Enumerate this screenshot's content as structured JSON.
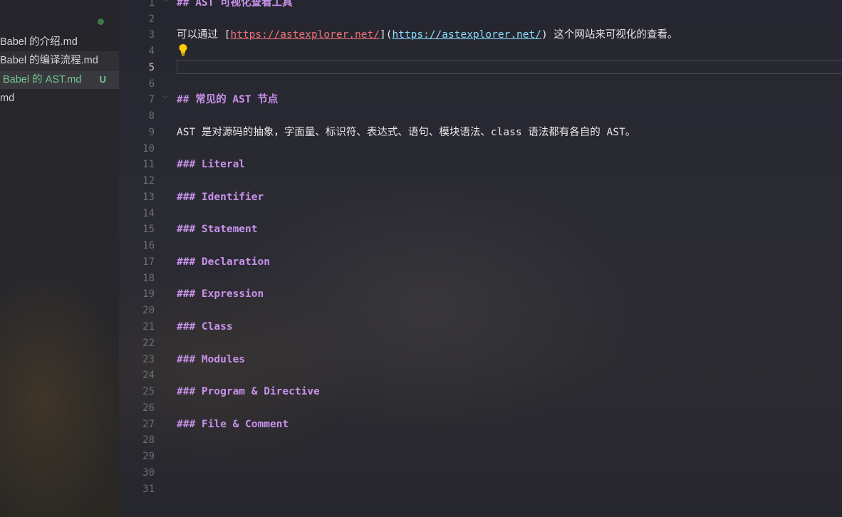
{
  "sidebar": {
    "items": [
      {
        "label": "Babel 的介绍.md",
        "git": ""
      },
      {
        "label": "Babel 的编译流程.md",
        "git": ""
      },
      {
        "label": "Babel 的 AST.md",
        "git": "U"
      },
      {
        "label": "md",
        "git": ""
      }
    ]
  },
  "editor": {
    "current_line": 5,
    "lines": [
      {
        "n": "1",
        "text": "## AST 可视化查看工具"
      },
      {
        "n": "2",
        "text": ""
      },
      {
        "n": "3",
        "prefix": "可以通过 [",
        "link_text": "https://astexplorer.net/",
        "mid": "](",
        "link_url": "https://astexplorer.net/",
        "suffix": ") 这个网站来可视化的查看。"
      },
      {
        "n": "4",
        "text": ""
      },
      {
        "n": "5",
        "text": ""
      },
      {
        "n": "6",
        "text": ""
      },
      {
        "n": "7",
        "text": "## 常见的 AST 节点"
      },
      {
        "n": "8",
        "text": ""
      },
      {
        "n": "9",
        "text": "AST 是对源码的抽象，字面量、标识符、表达式、语句、模块语法、class 语法都有各自的 AST。"
      },
      {
        "n": "10",
        "text": ""
      },
      {
        "n": "11",
        "text": "### Literal"
      },
      {
        "n": "12",
        "text": ""
      },
      {
        "n": "13",
        "text": "### Identifier"
      },
      {
        "n": "14",
        "text": ""
      },
      {
        "n": "15",
        "text": "### Statement"
      },
      {
        "n": "16",
        "text": ""
      },
      {
        "n": "17",
        "text": "### Declaration"
      },
      {
        "n": "18",
        "text": ""
      },
      {
        "n": "19",
        "text": "### Expression"
      },
      {
        "n": "20",
        "text": ""
      },
      {
        "n": "21",
        "text": "### Class"
      },
      {
        "n": "22",
        "text": ""
      },
      {
        "n": "23",
        "text": "### Modules"
      },
      {
        "n": "24",
        "text": ""
      },
      {
        "n": "25",
        "text": "### Program & Directive"
      },
      {
        "n": "26",
        "text": ""
      },
      {
        "n": "27",
        "text": "### File & Comment"
      },
      {
        "n": "28",
        "text": ""
      },
      {
        "n": "29",
        "text": ""
      },
      {
        "n": "30",
        "text": ""
      },
      {
        "n": "31",
        "text": ""
      }
    ]
  },
  "icons": {
    "lightbulb": "lightbulb-icon",
    "fold": "chevron-down-icon",
    "modified_dot": "git-modified-dot-icon"
  },
  "colors": {
    "heading": "#c792ea",
    "link_text": "#f07178",
    "link_url": "#89ddff",
    "untracked": "#73c991",
    "bulb": "#ffcc00"
  }
}
